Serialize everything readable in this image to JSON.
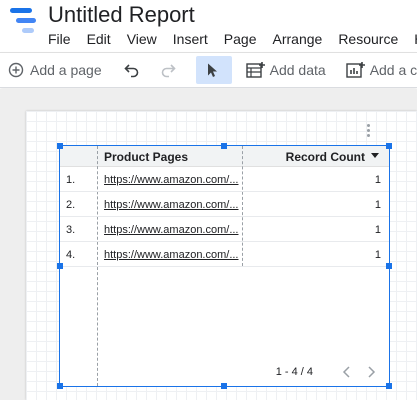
{
  "app": {
    "title": "Untitled Report"
  },
  "menu": {
    "items": [
      "File",
      "Edit",
      "View",
      "Insert",
      "Page",
      "Arrange",
      "Resource",
      "He"
    ]
  },
  "toolbar": {
    "add_page_label": "Add a page",
    "add_data_label": "Add data",
    "add_chart_label": "Add a chart"
  },
  "table": {
    "columns": [
      "Product Pages",
      "Record Count"
    ],
    "rows": [
      {
        "num": "1.",
        "url": "https://www.amazon.com/...",
        "count": "1"
      },
      {
        "num": "2.",
        "url": "https://www.amazon.com/...",
        "count": "1"
      },
      {
        "num": "3.",
        "url": "https://www.amazon.com/...",
        "count": "1"
      },
      {
        "num": "4.",
        "url": "https://www.amazon.com/...",
        "count": "1"
      }
    ],
    "pagination": "1 - 4 / 4"
  },
  "colors": {
    "accent": "#1a73e8",
    "selected_tool_bg": "#d2e3fc"
  },
  "icons": [
    "logo-icon",
    "add-page-icon",
    "undo-icon",
    "redo-icon",
    "select-pointer-icon",
    "add-data-icon",
    "add-chart-icon",
    "more-vert-icon",
    "sort-desc-icon",
    "chevron-left-icon",
    "chevron-right-icon"
  ]
}
